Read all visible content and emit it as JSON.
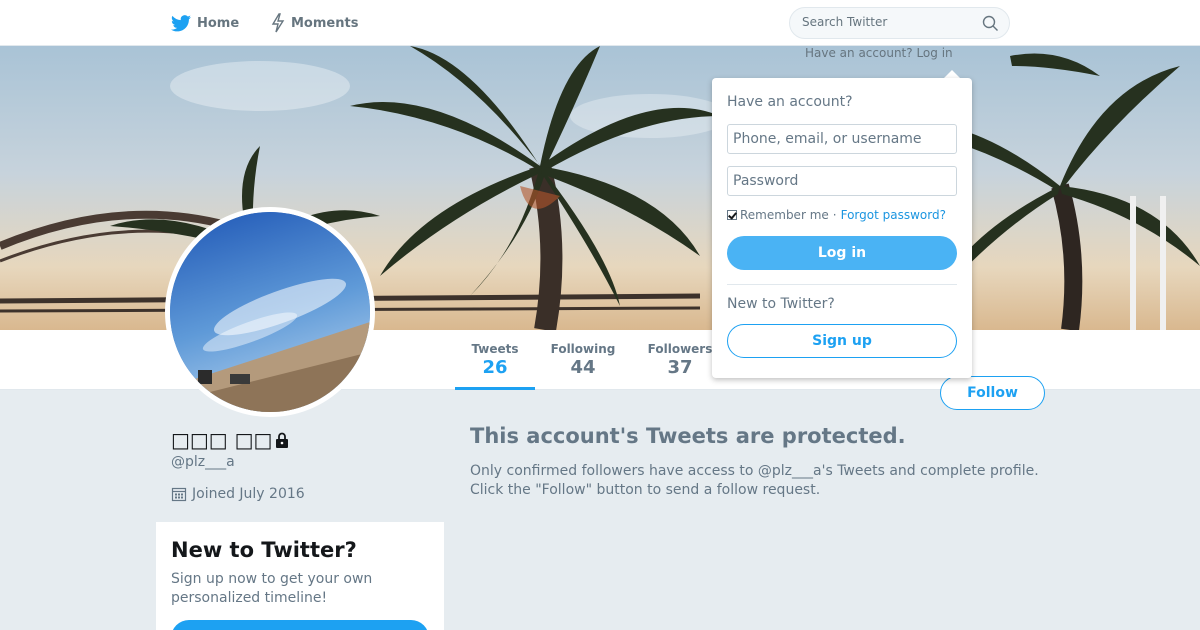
{
  "topnav": {
    "home_label": "Home",
    "moments_label": "Moments",
    "search_placeholder": "Search Twitter"
  },
  "header": {
    "have_account_link": "Have an account? Log in"
  },
  "profile_nav": {
    "tweets_label": "Tweets",
    "tweets_count": "26",
    "following_label": "Following",
    "following_count": "44",
    "followers_label": "Followers",
    "followers_count": "37",
    "follow_label": "Follow"
  },
  "profile": {
    "display_name": "□□□ □□",
    "handle": "@plz___a",
    "joined": "Joined July 2016"
  },
  "signup_module": {
    "title": "New to Twitter?",
    "text": "Sign up now to get your own personalized timeline!"
  },
  "protected": {
    "title": "This account's Tweets are protected.",
    "line1": "Only confirmed followers have access to @plz___a's Tweets and complete profile.",
    "line2": "Click the \"Follow\" button to send a follow request."
  },
  "login": {
    "heading": "Have an account?",
    "username_placeholder": "Phone, email, or username",
    "password_placeholder": "Password",
    "remember_label": "Remember me",
    "separator": "·",
    "forgot_label": "Forgot password?",
    "login_label": "Log in",
    "new_heading": "New to Twitter?",
    "signup_label": "Sign up"
  },
  "colors": {
    "accent": "#1da1f2",
    "background": "#e6ecf0",
    "text_secondary": "#657786"
  }
}
